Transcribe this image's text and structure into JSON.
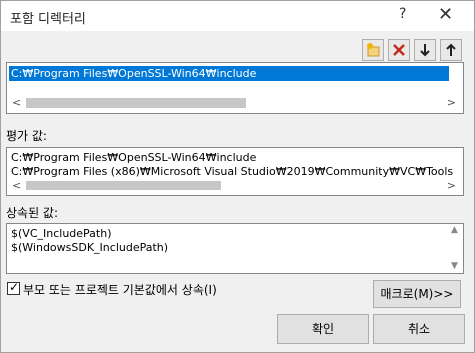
{
  "window": {
    "title": "포함 디렉터리",
    "help_glyph": "?",
    "close_glyph": "✕"
  },
  "toolbar": {
    "icons": [
      "new-line-icon",
      "delete-icon",
      "move-down-icon",
      "move-up-icon"
    ],
    "delete_color": "#c42b1c"
  },
  "include_list": {
    "items": [
      "C:₩Program Files₩OpenSSL-Win64₩include"
    ],
    "selected_index": 0,
    "selection_color": "#0078d7"
  },
  "evaluated": {
    "label": "평가 값:",
    "lines": [
      "C:₩Program Files₩OpenSSL-Win64₩include",
      "C:₩Program Files (x86)₩Microsoft Visual Studio₩2019₩Community₩VC₩Tools"
    ]
  },
  "inherited": {
    "label": "상속된 값:",
    "lines": [
      "$(VC_IncludePath)",
      "$(WindowsSDK_IncludePath)"
    ]
  },
  "inherit_checkbox": {
    "checked": true,
    "label": "부모 또는 프로젝트 기본값에서 상속(I)"
  },
  "buttons": {
    "macros": "매크로(M)>>",
    "ok": "확인",
    "cancel": "취소"
  }
}
